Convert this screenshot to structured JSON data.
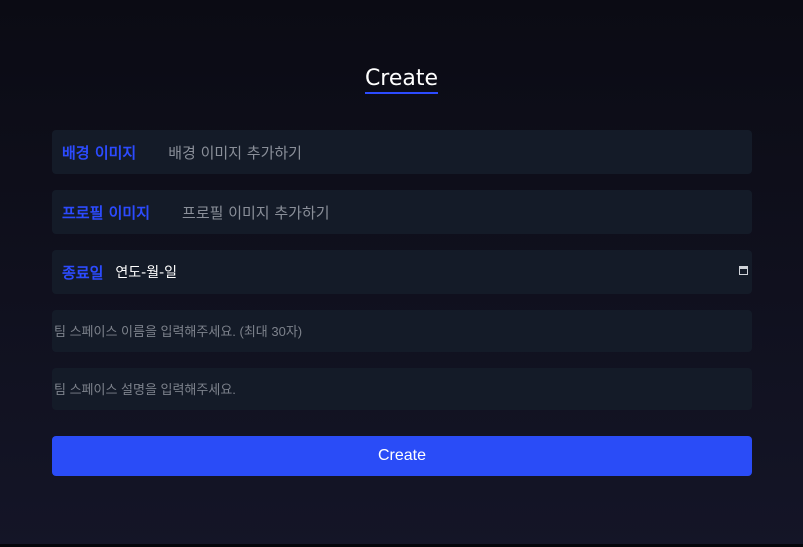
{
  "title": "Create",
  "form": {
    "background_image": {
      "label": "배경 이미지",
      "placeholder": "배경 이미지 추가하기"
    },
    "profile_image": {
      "label": "프로필 이미지",
      "placeholder": "프로필 이미지 추가하기"
    },
    "end_date": {
      "label": "종료일",
      "value": "연도-월-일",
      "icon": "calendar-icon"
    },
    "name_input": {
      "placeholder": "팀 스페이스 이름을 입력해주세요. (최대 30자)"
    },
    "description_input": {
      "placeholder": "팀 스페이스 설명을 입력해주세요."
    },
    "submit_label": "Create"
  },
  "colors": {
    "accent": "#2a4cf7",
    "field_background": "#141b28",
    "page_background": "#0b0b14"
  }
}
